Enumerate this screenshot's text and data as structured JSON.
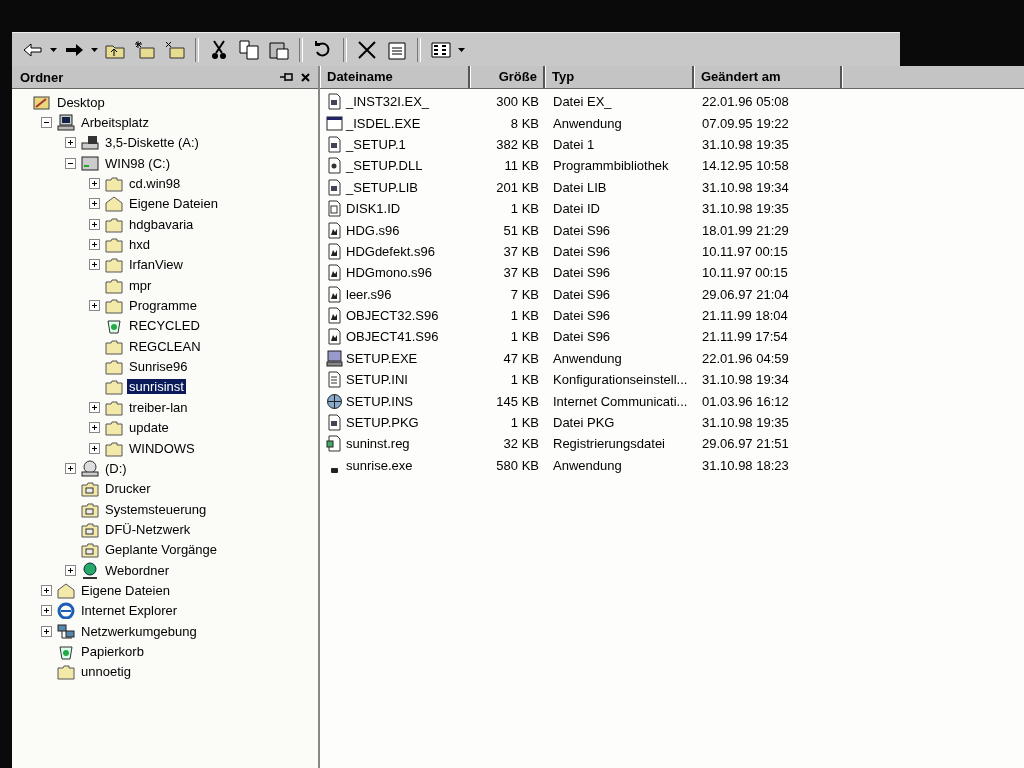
{
  "folders_pane": {
    "title": "Ordner",
    "tree": [
      {
        "label": "Desktop",
        "kind": "desktop",
        "selected": false,
        "children": [
          {
            "label": "Arbeitsplatz",
            "kind": "computer",
            "expanded": true,
            "selected": false,
            "children": [
              {
                "label": "3,5-Diskette (A:)",
                "kind": "floppy",
                "expanded": false,
                "selected": false
              },
              {
                "label": "WIN98 (C:)",
                "kind": "drive",
                "expanded": true,
                "selected": false,
                "children": [
                  {
                    "label": "cd.win98",
                    "kind": "folder",
                    "expanded": false,
                    "selected": false
                  },
                  {
                    "label": "Eigene Dateien",
                    "kind": "home",
                    "expanded": false,
                    "selected": false
                  },
                  {
                    "label": "hdgbavaria",
                    "kind": "folder",
                    "expanded": false,
                    "selected": false
                  },
                  {
                    "label": "hxd",
                    "kind": "folder",
                    "expanded": false,
                    "selected": false
                  },
                  {
                    "label": "IrfanView",
                    "kind": "folder",
                    "expanded": false,
                    "selected": false
                  },
                  {
                    "label": "mpr",
                    "kind": "folder",
                    "selected": false
                  },
                  {
                    "label": "Programme",
                    "kind": "folder",
                    "expanded": false,
                    "selected": false
                  },
                  {
                    "label": "RECYCLED",
                    "kind": "recycle",
                    "selected": false
                  },
                  {
                    "label": "REGCLEAN",
                    "kind": "folder",
                    "selected": false
                  },
                  {
                    "label": "Sunrise96",
                    "kind": "folder",
                    "selected": false
                  },
                  {
                    "label": "sunrisinst",
                    "kind": "folder",
                    "selected": true
                  },
                  {
                    "label": "treiber-lan",
                    "kind": "folder",
                    "expanded": false,
                    "selected": false
                  },
                  {
                    "label": "update",
                    "kind": "folder",
                    "expanded": false,
                    "selected": false
                  },
                  {
                    "label": "WINDOWS",
                    "kind": "folder",
                    "expanded": false,
                    "selected": false
                  }
                ]
              },
              {
                "label": "(D:)",
                "kind": "cdrom",
                "expanded": false,
                "selected": false
              },
              {
                "label": "Drucker",
                "kind": "system",
                "selected": false
              },
              {
                "label": "Systemsteuerung",
                "kind": "system",
                "selected": false
              },
              {
                "label": "DFÜ-Netzwerk",
                "kind": "system",
                "selected": false
              },
              {
                "label": "Geplante Vorgänge",
                "kind": "system",
                "selected": false
              },
              {
                "label": "Webordner",
                "kind": "globe",
                "expanded": false,
                "selected": false
              }
            ]
          },
          {
            "label": "Eigene Dateien",
            "kind": "home",
            "expanded": false,
            "selected": false
          },
          {
            "label": "Internet Explorer",
            "kind": "browser",
            "expanded": false,
            "selected": false
          },
          {
            "label": "Netzwerkumgebung",
            "kind": "network",
            "expanded": false,
            "selected": false
          },
          {
            "label": "Papierkorb",
            "kind": "recycle",
            "selected": false
          },
          {
            "label": "unnoetig",
            "kind": "folder",
            "selected": false
          }
        ]
      }
    ]
  },
  "file_list": {
    "columns": [
      "Dateiname",
      "Größe",
      "Typ",
      "Geändert am"
    ],
    "rows": [
      {
        "name": "_INST32I.EX_",
        "size": "300 KB",
        "type": "Datei EX_",
        "modified": "22.01.96 05:08",
        "kind": "doc"
      },
      {
        "name": "_ISDEL.EXE",
        "size": "8 KB",
        "type": "Anwendung",
        "modified": "07.09.95 19:22",
        "kind": "window"
      },
      {
        "name": "_SETUP.1",
        "size": "382 KB",
        "type": "Datei 1",
        "modified": "31.10.98 19:35",
        "kind": "doc"
      },
      {
        "name": "_SETUP.DLL",
        "size": "11 KB",
        "type": "Programmbibliothek",
        "modified": "14.12.95 10:58",
        "kind": "dll"
      },
      {
        "name": "_SETUP.LIB",
        "size": "201 KB",
        "type": "Datei LIB",
        "modified": "31.10.98 19:34",
        "kind": "doc"
      },
      {
        "name": "DISK1.ID",
        "size": "1 KB",
        "type": "Datei ID",
        "modified": "31.10.98 19:35",
        "kind": "id"
      },
      {
        "name": "HDG.s96",
        "size": "51 KB",
        "type": "Datei S96",
        "modified": "18.01.99 21:29",
        "kind": "s96"
      },
      {
        "name": "HDGdefekt.s96",
        "size": "37 KB",
        "type": "Datei S96",
        "modified": "10.11.97 00:15",
        "kind": "s96"
      },
      {
        "name": "HDGmono.s96",
        "size": "37 KB",
        "type": "Datei S96",
        "modified": "10.11.97 00:15",
        "kind": "s96"
      },
      {
        "name": "leer.s96",
        "size": "7 KB",
        "type": "Datei S96",
        "modified": "29.06.97 21:04",
        "kind": "s96"
      },
      {
        "name": "OBJECT32.S96",
        "size": "1 KB",
        "type": "Datei S96",
        "modified": "21.11.99 18:04",
        "kind": "s96"
      },
      {
        "name": "OBJECT41.S96",
        "size": "1 KB",
        "type": "Datei S96",
        "modified": "21.11.99 17:54",
        "kind": "s96"
      },
      {
        "name": "SETUP.EXE",
        "size": "47 KB",
        "type": "Anwendung",
        "modified": "22.01.96 04:59",
        "kind": "setup"
      },
      {
        "name": "SETUP.INI",
        "size": "1 KB",
        "type": "Konfigurationseinstell...",
        "modified": "31.10.98 19:34",
        "kind": "ini"
      },
      {
        "name": "SETUP.INS",
        "size": "145 KB",
        "type": "Internet Communicati...",
        "modified": "01.03.96 16:12",
        "kind": "globe"
      },
      {
        "name": "SETUP.PKG",
        "size": "1 KB",
        "type": "Datei PKG",
        "modified": "31.10.98 19:35",
        "kind": "doc"
      },
      {
        "name": "suninst.reg",
        "size": "32 KB",
        "type": "Registrierungsdatei",
        "modified": "29.06.97 21:51",
        "kind": "reg"
      },
      {
        "name": "sunrise.exe",
        "size": "580 KB",
        "type": "Anwendung",
        "modified": "31.10.98 18:23",
        "kind": "small"
      }
    ]
  }
}
